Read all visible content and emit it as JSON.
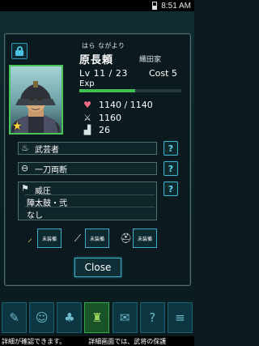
{
  "status_bar": {
    "time": "8:51 AM"
  },
  "officer": {
    "ruby": "はら ながより",
    "name": "原長頼",
    "clan": "織田家",
    "level": "Lv 11 / 23",
    "cost": "Cost 5",
    "exp_label": "Exp",
    "exp_progress": 0.55,
    "hp": "1140  / 1140",
    "attack": "1160",
    "speed": "26"
  },
  "skills": [
    {
      "label": "武芸者",
      "icon": "flame-icon"
    },
    {
      "label": "一刀両断",
      "icon": "slash-icon"
    }
  ],
  "tactic": {
    "label": "威圧",
    "formation": "陣太鼓・弐",
    "extra": "なし",
    "icon": "flag-icon"
  },
  "equipment": [
    {
      "label": "未装備",
      "icon": "sword-icon"
    },
    {
      "label": "未装備",
      "icon": "spear-icon"
    },
    {
      "label": "未装備",
      "icon": "helmet-icon"
    }
  ],
  "close_label": "Close",
  "help_label": "?",
  "toolbar": {
    "buttons": [
      {
        "icon": "scroll-icon",
        "active": false
      },
      {
        "icon": "person-icon",
        "active": false
      },
      {
        "icon": "tree-icon",
        "active": false
      },
      {
        "icon": "castle-icon",
        "active": true
      },
      {
        "icon": "chat-icon",
        "active": false
      },
      {
        "icon": "help-icon",
        "active": false
      },
      {
        "icon": "menu-icon",
        "active": false
      }
    ]
  },
  "ticker": {
    "left": "詳細が確認できます。",
    "right": "詳細画面では、武将の保護"
  },
  "colors": {
    "accent": "#3aaec9",
    "exp": "#3fbf54",
    "portrait_frame": "#48c45a"
  }
}
